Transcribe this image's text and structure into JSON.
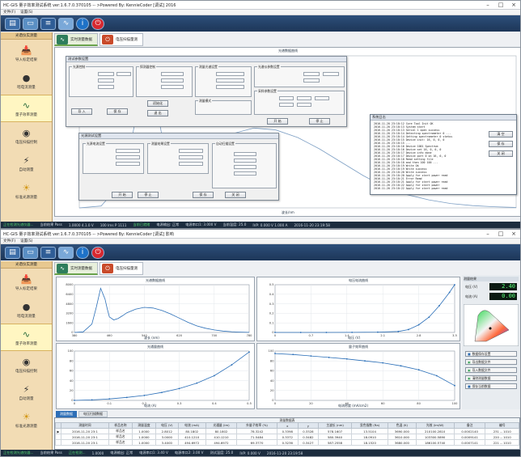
{
  "window1": {
    "title": "HC-GIS 量子效率测试系统  ver:1.6.7.0.370105 -- >Powered By: KennieCoder  [调试]  2016",
    "status": [
      "正在检测光谱仪器...",
      "当前结果 Pass",
      "1.0000 4.1.0 V",
      "100 Ims P 1111",
      "当前已就绪",
      "电源输出: 正常",
      "电源串口1: 3.000 V",
      "当前温度: 25.0",
      "IVP: 0.000 V 1.000 A",
      "2016-11-20 23:19:58"
    ]
  },
  "window2": {
    "title": "HC-GIS 量子效率测试系统  ver:1.6.7.0.370105 -- >Powered By: KennieCoder  [调试]  影响",
    "status": [
      "正在检测光谱仪器...",
      "当前结果 Pass",
      "正在检测...",
      "1.0000",
      "电源输出: 正常",
      "电源串口1: 3.40 V",
      "电源串口2: 3.00 V",
      "测试温度: 25.0",
      "IVP: 0.000 V",
      "2016-11-20 23:19:58"
    ]
  },
  "menus": [
    "文件(F)",
    "设置(S)"
  ],
  "toolbar": [
    "new-doc-icon",
    "open-icon",
    "list-icon",
    "chart-icon",
    "info-icon",
    "power-icon"
  ],
  "sidebar": {
    "header": "光谱仪实测量",
    "items": [
      {
        "label": "导入标定结果",
        "icon": "import-icon"
      },
      {
        "label": "暗电流测量",
        "icon": "dark-current-icon"
      },
      {
        "label": "量子效率测量",
        "icon": "spectrum-icon"
      },
      {
        "label": "电压扫描控制",
        "icon": "voltage-scan-icon"
      },
      {
        "label": "自动测量",
        "icon": "auto-measure-icon"
      },
      {
        "label": "标准光源测量",
        "icon": "lamp-icon"
      }
    ]
  },
  "tabs": [
    {
      "label": "实时测量数据",
      "icon": "realtime-icon"
    },
    {
      "label": "电压扫描量测",
      "icon": "scan-icon"
    }
  ],
  "w1_panel_main": {
    "title": "测试参数设置",
    "groups": [
      "光源控制",
      "探测器控制",
      "测量光谱设置",
      "光谱仪参数设置",
      "采样参数设置",
      "测量模式"
    ],
    "buttons": [
      "导 入",
      "保 存",
      "初始化",
      "退 出",
      "开 始",
      "停 止"
    ]
  },
  "w1_panel_small": {
    "title": "光源测试设置",
    "groups": [
      "光源电流设置",
      "测量结果设置",
      "自动扫描设置"
    ],
    "buttons": [
      "开 始",
      "停 止",
      "保 存",
      "关 闭"
    ]
  },
  "w1_spectrum": {
    "title": "光谱数据曲线",
    "xlabel": "波长/nm",
    "ylabel": "强度"
  },
  "log": {
    "title": "系统日志",
    "lines": [
      "2016-11-20 23:18:12  Core Tool Init OK",
      "2016-11-20 23:18:13  System start",
      "2016-11-20 23:18:13  Serial 1 open success",
      "2016-11-20 23:18:14  Detecting spectrometer 0 ...",
      "2016-11-20 23:18:14  Getting spectrometer 0 status",
      "2016-11-20 23:18:15  Device init: 16, 0, 0, 0",
      "2016-11-20 23:18:15  ...",
      "2016-11-20 23:18:16  Device 1001 Spectrum",
      "2016-11-20 23:18:16  Device set 16, 0, 0, 0",
      "2016-11-20 23:18:17  Device info done",
      "2016-11-20 23:18:17  Device port 0 on 16, 0, 0",
      "2016-11-20 23:18:18  Read setting file",
      "2016-11-20 23:18:18  and then 100 100 ...",
      "2016-11-20 23:18:19  Write Ok",
      "2016-11-20 23:18:19  Write success",
      "2016-11-20 23:18:20  Write success",
      "2016-11-20 23:18:20  Apply for start power read",
      "2016-11-20 23:18:21  Error Read",
      "2016-11-20 23:18:21  Apply for start power read",
      "2016-11-20 23:18:22  Apply for start power",
      "2016-11-20 23:18:22  Apply for start power read"
    ],
    "buttons": [
      "清 空",
      "保 存",
      "关 闭"
    ]
  },
  "charts": [
    {
      "title": "光谱数据曲线",
      "xlabel": "波长 (nm)",
      "ylabel": "强度"
    },
    {
      "title": "电压电流曲线",
      "xlabel": "电压 (V)",
      "ylabel": "电流 (A)"
    },
    {
      "title": "光通量曲线",
      "xlabel": "电流 (A)",
      "ylabel": "光通量"
    },
    {
      "title": "量子效率曲线",
      "xlabel": "电流密度 (mA/cm2)",
      "ylabel": "EQE"
    }
  ],
  "readouts": {
    "title": "测量结果",
    "value1": "2.40",
    "value2": "0.00",
    "label1": "电压 (V)",
    "label2": "电流 (A)"
  },
  "side_buttons": [
    "数据保存设置",
    "导出数据文件",
    "导入数据文件",
    "清除测量数据",
    "保存当前数据"
  ],
  "table_tabs": [
    "测量数据",
    "电压扫描数据"
  ],
  "table_caption": "测量数据表",
  "table": {
    "headers": [
      "测量时间",
      "样品名称",
      "测量温度",
      "电压 (V)",
      "电流 (mA)",
      "光通量 (lm)",
      "外量子效率 (%)",
      "x",
      "y",
      "主波长 (nm)",
      "显色指数 (Ra)",
      "色温 (K)",
      "光效 (lm/W)",
      "备注",
      "编号"
    ],
    "rows": [
      [
        "2016-11-20 23:1",
        "样品名",
        "1.0000",
        "2.8012",
        "80.1802",
        "80.1802",
        "78.3242",
        "0.3398",
        "0.3328",
        "578.1607",
        "13.5104",
        "3690.000",
        "210100.2810",
        "0.0002140",
        "231 -- 1010"
      ],
      [
        "2016-11-20 23:1",
        "样品名",
        "1.0000",
        "3.0000",
        "410.1210",
        "410.1210",
        "71.5484",
        "0.3372",
        "0.3482",
        "580.3940",
        "18.0910",
        "3610.000",
        "103300.5890",
        "0.0009141",
        "220 -- 1010"
      ],
      [
        "2016-11-20 23:1",
        "样品名",
        "1.0000",
        "3.4000",
        "494.6972",
        "494.6972",
        "69.3770",
        "0.3236",
        "0.3427",
        "587.2558",
        "18.1520",
        "3680.000",
        "186100.5740",
        "0.0007141",
        "221 -- 1010"
      ]
    ]
  },
  "chart_data": [
    {
      "type": "line",
      "title": "光谱数据曲线",
      "xlabel": "波长 (nm)",
      "ylabel": "强度",
      "xlim": [
        380,
        780
      ],
      "ylim": [
        0,
        8000
      ],
      "x": [
        380,
        400,
        420,
        430,
        440,
        450,
        455,
        460,
        470,
        480,
        490,
        500,
        520,
        540,
        560,
        580,
        600,
        620,
        640,
        660,
        680,
        700,
        720,
        740,
        760,
        780
      ],
      "y": [
        0,
        100,
        1400,
        4200,
        7400,
        5600,
        4000,
        2600,
        2100,
        2350,
        2800,
        3300,
        3900,
        4200,
        4100,
        3700,
        3100,
        2400,
        1700,
        1100,
        700,
        420,
        230,
        120,
        60,
        20
      ]
    },
    {
      "type": "line",
      "title": "电压电流曲线",
      "xlabel": "电压 (V)",
      "ylabel": "电流 (A)",
      "xlim": [
        0,
        3.5
      ],
      "ylim": [
        0,
        0.5
      ],
      "x": [
        0,
        0.5,
        1.0,
        1.5,
        2.0,
        2.4,
        2.6,
        2.8,
        3.0,
        3.2,
        3.4,
        3.5
      ],
      "y": [
        0,
        0,
        0,
        0.001,
        0.003,
        0.01,
        0.03,
        0.08,
        0.16,
        0.28,
        0.42,
        0.5
      ]
    },
    {
      "type": "line",
      "title": "光通量曲线",
      "xlabel": "电流 (A)",
      "ylabel": "光通量",
      "xlim": [
        0,
        0.5
      ],
      "ylim": [
        0,
        100
      ],
      "x": [
        0,
        0.05,
        0.1,
        0.15,
        0.2,
        0.25,
        0.3,
        0.35,
        0.4,
        0.45,
        0.5
      ],
      "y": [
        0,
        1,
        3,
        6,
        10,
        16,
        24,
        35,
        50,
        72,
        98
      ]
    },
    {
      "type": "line",
      "title": "量子效率曲线",
      "xlabel": "电流密度 (mA/cm2)",
      "ylabel": "EQE",
      "xlim": [
        0,
        100
      ],
      "ylim": [
        0,
        100
      ],
      "x": [
        0,
        10,
        20,
        30,
        40,
        50,
        60,
        70,
        80,
        90,
        100
      ],
      "y": [
        95,
        93,
        90,
        87,
        84,
        80,
        76,
        70,
        62,
        50,
        30
      ]
    }
  ]
}
